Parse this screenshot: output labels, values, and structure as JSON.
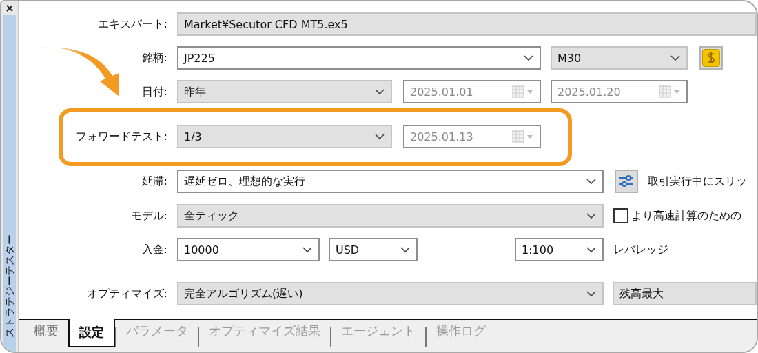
{
  "sidebar": {
    "close": "×",
    "title": "ストラテジーテスター"
  },
  "rows": [
    {
      "label": "エキスパート:",
      "controls": [
        {
          "kind": "readonly",
          "value": "Market¥Secutor CFD MT5.ex5"
        }
      ]
    },
    {
      "label": "銘柄:",
      "controls": [
        {
          "kind": "combo",
          "value": "JP225"
        },
        {
          "kind": "dropdown",
          "value": "M30"
        },
        {
          "kind": "symbol_button"
        }
      ]
    },
    {
      "label": "日付:",
      "controls": [
        {
          "kind": "dropdown",
          "value": "昨年"
        },
        {
          "kind": "date",
          "value": "2025.01.01",
          "disabled": true
        },
        {
          "kind": "date",
          "value": "2025.01.20",
          "disabled": true
        }
      ]
    },
    {
      "label": "フォワードテスト:",
      "highlighted": true,
      "controls": [
        {
          "kind": "dropdown",
          "value": "1/3"
        },
        {
          "kind": "date",
          "value": "2025.01.13",
          "disabled": true
        }
      ]
    },
    {
      "label": "延滞:",
      "controls": [
        {
          "kind": "combo",
          "value": "遅延ゼロ、理想的な実行"
        },
        {
          "kind": "settings_button"
        },
        {
          "kind": "text",
          "value": "取引実行中にスリッ"
        }
      ]
    },
    {
      "label": "モデル:",
      "controls": [
        {
          "kind": "dropdown",
          "value": "全ティック"
        },
        {
          "kind": "checkbox",
          "value": "より高速計算のための",
          "checked": false
        }
      ]
    },
    {
      "label": "入金:",
      "controls": [
        {
          "kind": "combo",
          "value": "10000"
        },
        {
          "kind": "combo",
          "value": "USD"
        },
        {
          "kind": "combo",
          "value": "1:100"
        },
        {
          "kind": "text",
          "value": "レバレッジ"
        }
      ]
    },
    {
      "label": "オプティマイズ:",
      "controls": [
        {
          "kind": "dropdown",
          "value": "完全アルゴリズム(遅い)"
        },
        {
          "kind": "dropdown",
          "value": "残高最大"
        }
      ]
    }
  ],
  "tabs": [
    {
      "label": "概要",
      "selected": false,
      "disabled": false
    },
    {
      "label": "設定",
      "selected": true,
      "disabled": false
    },
    {
      "label": "パラメータ",
      "selected": false,
      "disabled": true
    },
    {
      "label": "オプティマイズ結果",
      "selected": false,
      "disabled": true
    },
    {
      "label": "エージェント",
      "selected": false,
      "disabled": true
    },
    {
      "label": "操作ログ",
      "selected": false,
      "disabled": true
    }
  ]
}
